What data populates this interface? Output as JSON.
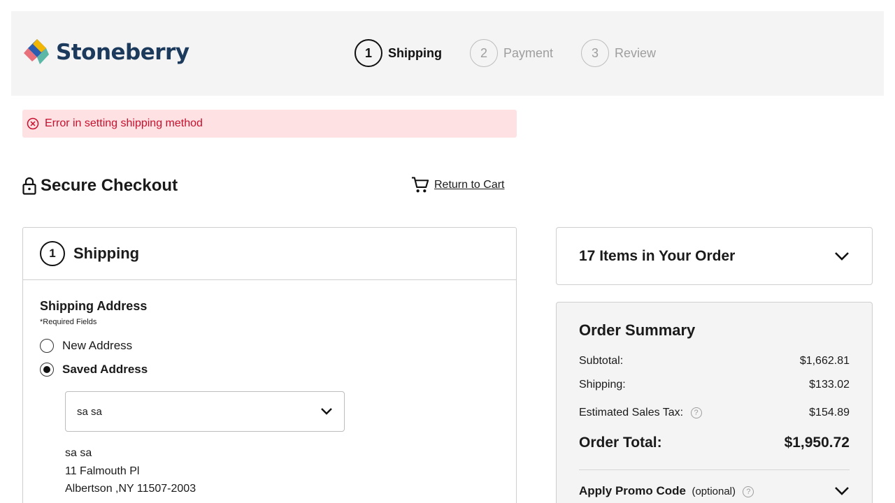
{
  "brand": {
    "name": "Stoneberry"
  },
  "steps": [
    {
      "number": "1",
      "label": "Shipping",
      "active": true
    },
    {
      "number": "2",
      "label": "Payment",
      "active": false
    },
    {
      "number": "3",
      "label": "Review",
      "active": false
    }
  ],
  "error": {
    "message": "Error in setting shipping method",
    "color": "#c8102e",
    "background": "#fde1e3"
  },
  "checkout": {
    "title": "Secure Checkout",
    "return_label": "Return to Cart"
  },
  "shipping": {
    "step_number": "1",
    "title": "Shipping",
    "address_title": "Shipping Address",
    "required_note": "*Required Fields",
    "options": [
      {
        "label": "New Address",
        "selected": false
      },
      {
        "label": "Saved Address",
        "selected": true
      }
    ],
    "selected_address": "sa sa",
    "address_lines": [
      "sa sa",
      "11 Falmouth Pl",
      "Albertson ,NY 11507-2003"
    ]
  },
  "order": {
    "items_title": "17 Items in Your Order",
    "summary_title": "Order Summary",
    "subtotal_label": "Subtotal:",
    "subtotal_value": "$1,662.81",
    "shipping_label": "Shipping:",
    "shipping_value": "$133.02",
    "tax_label": "Estimated Sales Tax:",
    "tax_value": "$154.89",
    "total_label": "Order Total:",
    "total_value": "$1,950.72",
    "promo_label": "Apply Promo Code",
    "promo_optional": "(optional)"
  },
  "icons": {
    "help": "?",
    "lock": "lock-icon",
    "cart": "cart-icon",
    "chevron": "chevron-down-icon",
    "error": "error-circle-icon"
  }
}
